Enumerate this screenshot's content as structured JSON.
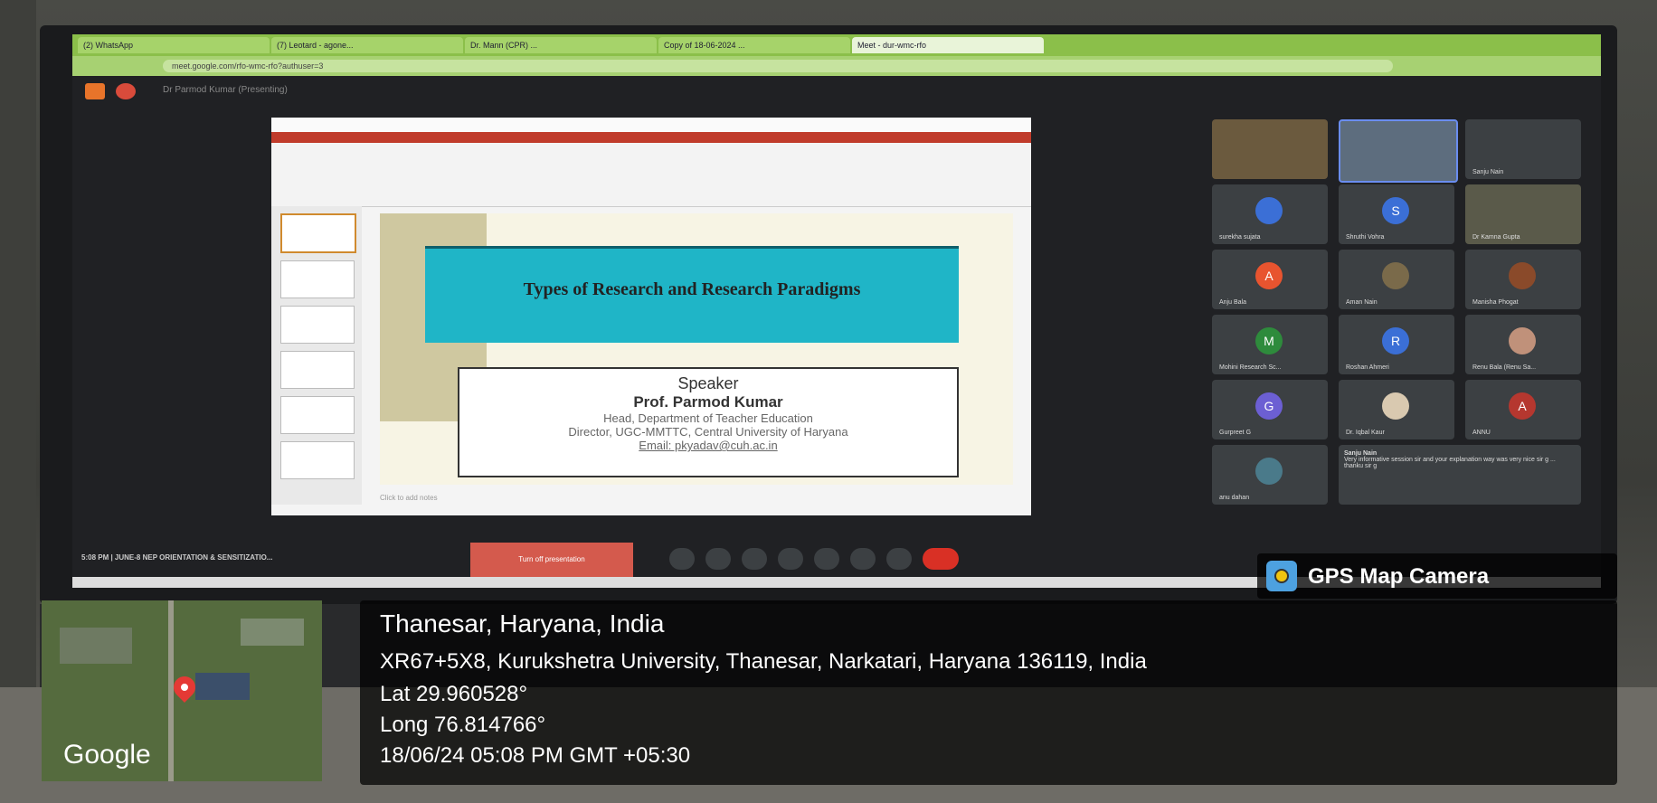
{
  "browser": {
    "tabs": [
      "(2) WhatsApp",
      "(7) Leotard - agone...",
      "Dr. Mann (CPR) ...",
      "Copy of 18-06-2024 ...",
      "Meet - dur-wmc-rfo"
    ],
    "address": "meet.google.com/rfo-wmc-rfo?authuser=3"
  },
  "meet": {
    "presenting": "Dr Parmod Kumar (Presenting)",
    "meeting_info": "5:08 PM | JUNE-8 NEP ORIENTATION & SENSITIZATIO...",
    "present_button": "Turn off presentation"
  },
  "slide": {
    "title": "Types of Research and Research Paradigms",
    "speaker_heading": "Speaker",
    "speaker_name": "Prof. Parmod Kumar",
    "role": "Head, Department of Teacher Education",
    "director": "Director, UGC-MMTTC, Central University of Haryana",
    "email": "Email: pkyadav@cuh.ac.in",
    "notes_hint": "Click to add notes"
  },
  "participants": [
    {
      "name": "",
      "initial": ""
    },
    {
      "name": "",
      "initial": ""
    },
    {
      "name": "Sanju Nain",
      "initial": ""
    },
    {
      "name": "surekha sujata",
      "initial": ""
    },
    {
      "name": "Shruthi Vohra",
      "initial": "S"
    },
    {
      "name": "Dr Kamna Gupta",
      "initial": ""
    },
    {
      "name": "Anju Bala",
      "initial": "A"
    },
    {
      "name": "Aman Nain",
      "initial": ""
    },
    {
      "name": "Manisha Phogat",
      "initial": ""
    },
    {
      "name": "Mohini Research Sc...",
      "initial": "M"
    },
    {
      "name": "Roshan Ahmeri",
      "initial": "R"
    },
    {
      "name": "Renu Bala (Renu Sa...",
      "initial": ""
    },
    {
      "name": "Gurpreet G",
      "initial": "G"
    },
    {
      "name": "Dr. Iqbal Kaur",
      "initial": ""
    },
    {
      "name": "ANNU",
      "initial": "A"
    },
    {
      "name": "anu dahan",
      "initial": ""
    }
  ],
  "chat": {
    "author": "Sanju Nain",
    "message": "Very informative session sir and your explanation way was very nice sir g ... thanku sir g"
  },
  "gps": {
    "badge": "GPS Map Camera",
    "map_label": "Google",
    "place": "Thanesar, Haryana, India",
    "address": "XR67+5X8, Kurukshetra University, Thanesar, Narkatari, Haryana 136119, India",
    "lat": "Lat 29.960528°",
    "long": "Long 76.814766°",
    "datetime": "18/06/24 05:08 PM GMT +05:30"
  },
  "colors": {
    "slide_header": "#1fb5c7",
    "avatar_orange": "#e8542f",
    "avatar_blue": "#3b6fd6",
    "avatar_green": "#2e8b3c",
    "avatar_purple": "#6c5fd3",
    "avatar_red": "#b5372f"
  }
}
